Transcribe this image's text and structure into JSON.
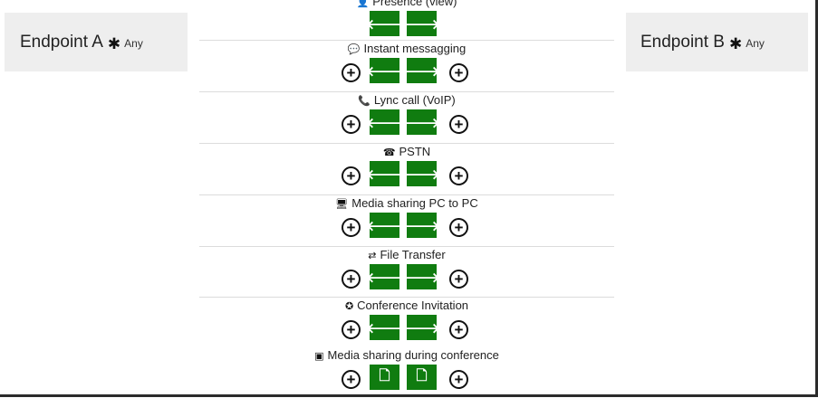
{
  "endpoint_a": {
    "title": "Endpoint A",
    "star_icon": "asterisk-icon",
    "subtitle": "Any"
  },
  "endpoint_b": {
    "title": "Endpoint B",
    "star_icon": "asterisk-icon",
    "subtitle": "Any"
  },
  "colors": {
    "button_green": "#107c10",
    "panel_bg": "#eeeeee",
    "separator": "#dcdcdc"
  },
  "rows": [
    {
      "label": "Presence (view)",
      "icon": "person-icon",
      "glyph_left": "🡐",
      "glyph_right": "🡒",
      "button_icon": "arrow",
      "has_plus": false
    },
    {
      "label": "Instant messagging",
      "icon": "chat-bubble-icon",
      "glyph_left": "🡐",
      "glyph_right": "🡒",
      "button_icon": "arrow",
      "has_plus": true
    },
    {
      "label": "Lync call (VoIP)",
      "icon": "phone-icon",
      "glyph_left": "🡐",
      "glyph_right": "🡒",
      "button_icon": "arrow",
      "has_plus": true
    },
    {
      "label": "PSTN",
      "icon": "phone-network-icon",
      "glyph_left": "🡐",
      "glyph_right": "🡒",
      "button_icon": "arrow",
      "has_plus": true
    },
    {
      "label": "Media sharing PC to PC",
      "icon": "monitor-icon",
      "glyph_left": "🡐",
      "glyph_right": "🡒",
      "button_icon": "arrow",
      "has_plus": true
    },
    {
      "label": "File Transfer",
      "icon": "transfer-icon",
      "glyph_left": "🡐",
      "glyph_right": "🡒",
      "button_icon": "arrow",
      "has_plus": true
    },
    {
      "label": "Conference Invitation",
      "icon": "conference-icon",
      "glyph_left": "🡐",
      "glyph_right": "🡒",
      "button_icon": "arrow",
      "has_plus": true
    },
    {
      "label": "Media sharing during conference",
      "icon": "slideshow-icon",
      "glyph_left": "🗋",
      "glyph_right": "🗋",
      "button_icon": "document",
      "has_plus": true
    }
  ]
}
